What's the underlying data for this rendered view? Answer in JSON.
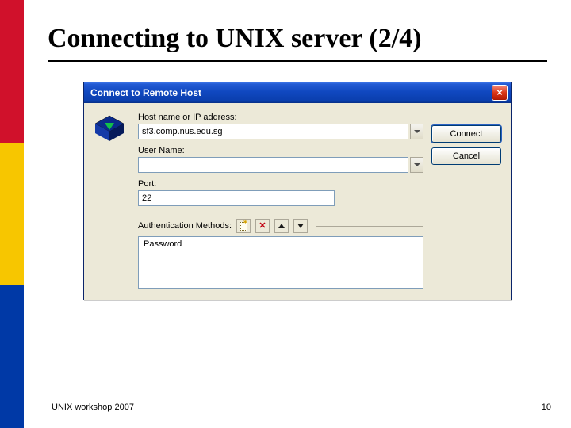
{
  "slide": {
    "title": "Connecting to UNIX server (2/4)",
    "footer_left": "UNIX workshop 2007",
    "page_number": "10"
  },
  "dialog": {
    "title": "Connect to Remote Host",
    "labels": {
      "host_full": "Host name or IP address:",
      "user_full": "User Name:",
      "port_full": "Port:",
      "auth_full": "Authentication Methods:"
    },
    "fields": {
      "host_value": "sf3.comp.nus.edu.sg",
      "user_value": "",
      "port_value": "22"
    },
    "auth_methods": [
      "Password"
    ],
    "buttons": {
      "connect": "Connect",
      "cancel": "Cancel"
    }
  }
}
